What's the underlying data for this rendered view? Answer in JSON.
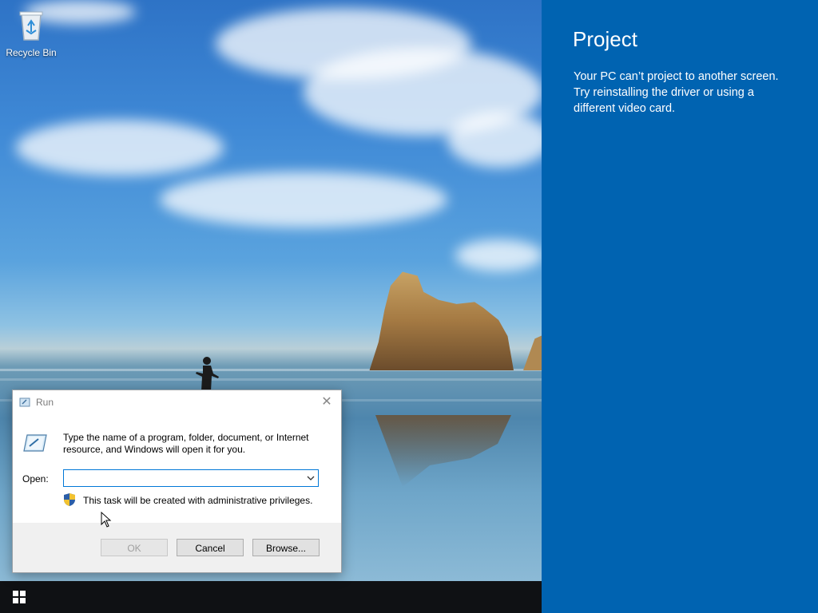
{
  "desktop": {
    "icons": [
      {
        "label": "Recycle Bin",
        "icon": "recycle-bin-icon"
      }
    ]
  },
  "taskbar": {
    "start_icon": "windows-logo-icon"
  },
  "project_panel": {
    "title": "Project",
    "message": "Your PC can’t project to another screen. Try reinstalling the driver or using a different video card.",
    "background": "#0063b1"
  },
  "run_dialog": {
    "title": "Run",
    "description": "Type the name of a program, folder, document, or Internet resource, and Windows will open it for you.",
    "open_label": "Open:",
    "open_value": "",
    "admin_note": "This task will be created with administrative privileges.",
    "buttons": {
      "ok": "OK",
      "cancel": "Cancel",
      "browse": "Browse..."
    }
  }
}
